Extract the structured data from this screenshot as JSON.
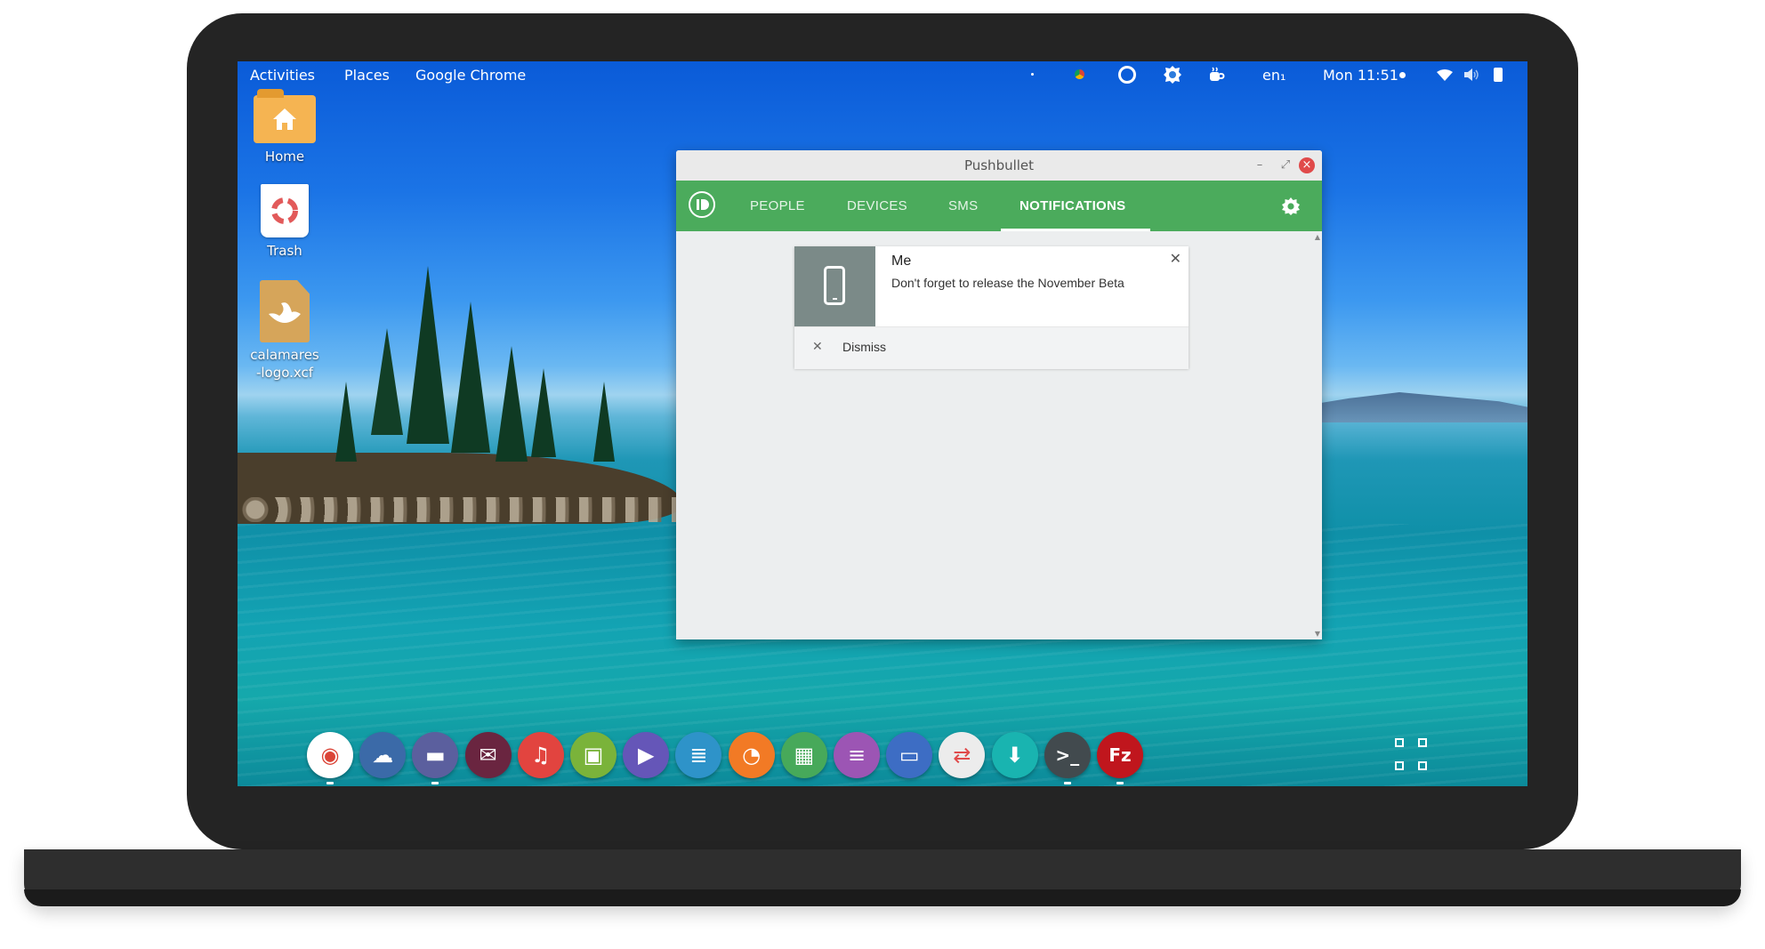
{
  "topbar": {
    "activities": "Activities",
    "places": "Places",
    "app_menu": "Google Chrome",
    "keyboard_layout": "en₁",
    "clock": "Mon 11:51",
    "tray_icons": [
      "dot-icon",
      "chrome-tray-icon",
      "sync-icon",
      "settings-tray-icon",
      "coffee-icon"
    ],
    "status_icons": [
      "wifi-icon",
      "volume-icon",
      "battery-icon"
    ]
  },
  "desktop": {
    "icons": [
      {
        "label": "Home",
        "icon": "home-folder-icon"
      },
      {
        "label": "Trash",
        "icon": "trash-icon"
      },
      {
        "label": "calamares-logo.xcf",
        "icon": "xcf-file-icon"
      }
    ]
  },
  "window": {
    "title": "Pushbullet",
    "controls": {
      "minimize": "–",
      "maximize": "⤢",
      "close": "×"
    },
    "tabs": [
      "PEOPLE",
      "DEVICES",
      "SMS",
      "NOTIFICATIONS"
    ],
    "active_tab": "NOTIFICATIONS",
    "notification": {
      "sender": "Me",
      "message": "Don't forget to release the November Beta",
      "dismiss_label": "Dismiss"
    }
  },
  "colors": {
    "accent": "#4bab5c",
    "window_bg": "#eceeef",
    "close_button": "#e04a4a"
  },
  "dock": {
    "items": [
      {
        "name": "chrome",
        "color": "#ffffff",
        "glyph": "◉"
      },
      {
        "name": "weather",
        "color": "#3b6aa8",
        "glyph": "☁"
      },
      {
        "name": "files",
        "color": "#5b5f9e",
        "glyph": "▬"
      },
      {
        "name": "mail",
        "color": "#6a2540",
        "glyph": "✉"
      },
      {
        "name": "music",
        "color": "#e2443f",
        "glyph": "♫"
      },
      {
        "name": "image-viewer",
        "color": "#7ab33a",
        "glyph": "▣"
      },
      {
        "name": "video",
        "color": "#6556b8",
        "glyph": "▶"
      },
      {
        "name": "text-editor",
        "color": "#2e93c9",
        "glyph": "≣"
      },
      {
        "name": "disk-usage",
        "color": "#f27a25",
        "glyph": "◔"
      },
      {
        "name": "spreadsheet",
        "color": "#47a95a",
        "glyph": "▦"
      },
      {
        "name": "document",
        "color": "#9c55b4",
        "glyph": "≡"
      },
      {
        "name": "presentation",
        "color": "#3d6dc4",
        "glyph": "▭"
      },
      {
        "name": "tweaks",
        "color": "#ececec",
        "glyph": "⇄"
      },
      {
        "name": "software-update",
        "color": "#19b4b0",
        "glyph": "⬇"
      },
      {
        "name": "terminal",
        "color": "#424a4e",
        "glyph": ">_"
      },
      {
        "name": "filezilla",
        "color": "#c0161d",
        "glyph": "Fz"
      }
    ]
  }
}
